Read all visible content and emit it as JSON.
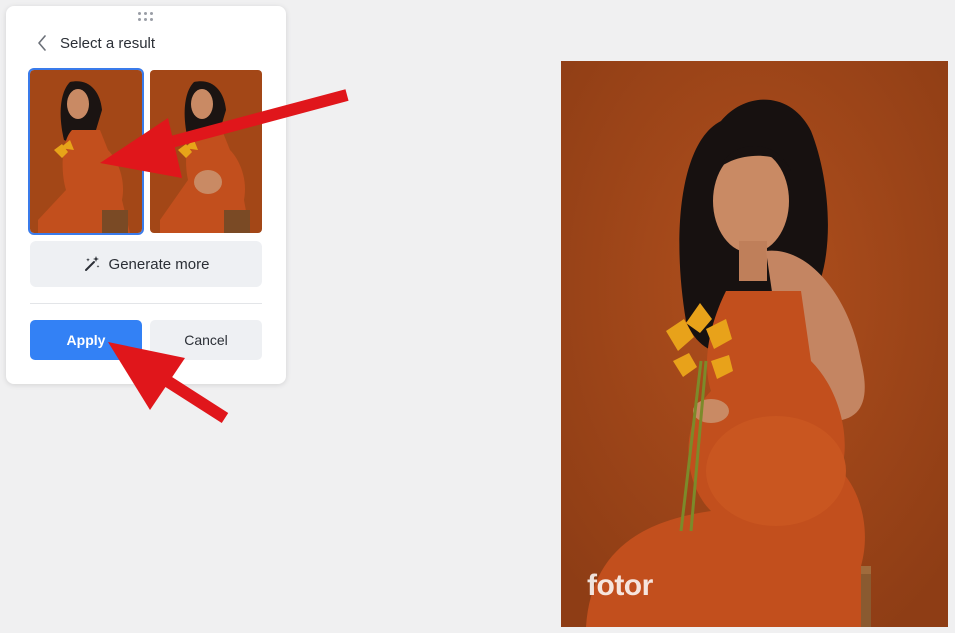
{
  "panel": {
    "title": "Select a result",
    "thumbnails": [
      {
        "label": "result-1",
        "selected": true
      },
      {
        "label": "result-2",
        "selected": false
      }
    ],
    "generate_more_label": "Generate more",
    "apply_label": "Apply",
    "cancel_label": "Cancel"
  },
  "preview": {
    "watermark": "fotor"
  },
  "colors": {
    "accent": "#3381f5",
    "annotation_arrow": "#e0161b",
    "backdrop": "#a34717",
    "dress": "#c24f1d"
  },
  "icons": [
    "drag-handle-icon",
    "back-chevron-icon",
    "magic-wand-icon"
  ]
}
